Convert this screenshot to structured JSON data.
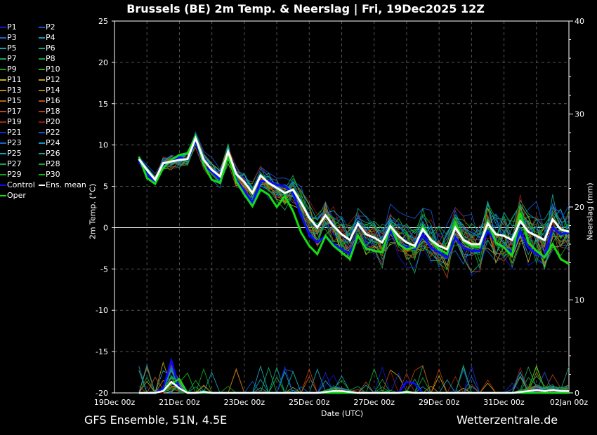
{
  "title": "Brussels  (BE)  2m Temp. & Neerslag | Fri, 19Dec2025 12Z",
  "footer_left": "GFS Ensemble, 51N, 4.5E",
  "footer_right": "Wetterzentrale.de",
  "chart_data": {
    "type": "line",
    "title": "Brussels  (BE)  2m Temp. & Neerslag | Fri, 19Dec2025 12Z",
    "xlabel": "Date (UTC)",
    "ylabel": "2m Temp. (°C)",
    "y2label": "Neerslag (mm)",
    "xlim_days": [
      0,
      14
    ],
    "x_start_day": 0.75,
    "x_step_days": 0.25,
    "ylim": [
      -20,
      25
    ],
    "y2lim": [
      0,
      40
    ],
    "yticks": [
      -20,
      -15,
      -10,
      -5,
      0,
      5,
      10,
      15,
      20,
      25
    ],
    "y2ticks": [
      0,
      10,
      20,
      30,
      40
    ],
    "xtick_labels": [
      "19Dec 00z",
      "21Dec 00z",
      "23Dec 00z",
      "25Dec 00z",
      "27Dec 00z",
      "29Dec 00z",
      "31Dec 00z",
      "02Jan 00z"
    ],
    "grid": true,
    "legend_position": "left-outside",
    "ens_mean": [
      8.3,
      7.0,
      5.8,
      7.8,
      8.0,
      8.2,
      8.3,
      10.8,
      8.2,
      7.0,
      6.2,
      9.2,
      6.5,
      5.5,
      4.2,
      6.3,
      5.4,
      4.8,
      4.2,
      4.6,
      3.0,
      1.2,
      0.0,
      1.5,
      0.2,
      -0.8,
      -1.5,
      0.5,
      -0.8,
      -1.2,
      -1.8,
      0.2,
      -1.0,
      -1.8,
      -2.2,
      -0.2,
      -1.5,
      -2.2,
      -2.6,
      0.0,
      -1.5,
      -2.0,
      -2.0,
      0.5,
      -0.8,
      -1.0,
      -1.5,
      0.8,
      -0.5,
      -1.0,
      -1.5,
      1.0,
      -0.2,
      -0.5
    ],
    "control": [
      8.0,
      6.5,
      5.5,
      7.5,
      8.0,
      8.5,
      8.2,
      10.5,
      7.5,
      6.8,
      5.8,
      8.8,
      5.8,
      4.5,
      3.0,
      5.6,
      5.6,
      5.2,
      5.0,
      4.2,
      1.5,
      -0.8,
      -1.8,
      -1.0,
      -2.0,
      -2.6,
      -3.2,
      -1.0,
      -2.4,
      -2.8,
      -3.0,
      -0.4,
      -2.0,
      -2.4,
      -2.6,
      -0.8,
      -2.4,
      -3.0,
      -3.6,
      -1.2,
      -2.4,
      -2.8,
      -2.8,
      -0.4,
      -1.8,
      -2.4,
      -3.0,
      -0.4,
      -2.4,
      -3.2,
      -3.6,
      0.0,
      -0.8,
      -0.6
    ],
    "oper": [
      8.6,
      6.0,
      5.3,
      7.2,
      8.2,
      8.8,
      9.0,
      11.0,
      7.6,
      5.8,
      5.4,
      8.6,
      5.6,
      4.0,
      2.6,
      4.6,
      4.0,
      2.5,
      3.8,
      2.0,
      -0.6,
      -2.2,
      -3.2,
      -1.0,
      -2.2,
      -3.0,
      -3.8,
      -1.0,
      -2.5,
      -2.8,
      -3.0,
      0.2,
      -2.0,
      -2.6,
      -2.4,
      0.2,
      -1.6,
      -2.6,
      -3.2,
      0.5,
      -1.6,
      -2.2,
      -2.4,
      0.8,
      -1.8,
      -2.4,
      -3.4,
      1.8,
      -1.8,
      -2.8,
      -3.6,
      -2.0,
      -3.8,
      -4.4
    ],
    "spread": [
      0.3,
      0.5,
      0.6,
      0.8,
      0.9,
      1.0,
      1.0,
      1.0,
      1.0,
      1.2,
      1.3,
      1.3,
      1.4,
      1.5,
      1.5,
      1.5,
      1.6,
      1.7,
      1.8,
      1.9,
      2.0,
      2.1,
      2.2,
      2.2,
      2.3,
      2.3,
      2.4,
      2.4,
      2.5,
      2.5,
      2.6,
      2.6,
      2.7,
      2.7,
      2.8,
      2.8,
      2.9,
      2.9,
      3.0,
      3.0,
      3.0,
      3.1,
      3.1,
      3.2,
      3.2,
      3.2,
      3.3,
      3.3,
      3.3,
      3.4,
      3.4,
      3.4,
      3.5,
      3.5
    ],
    "precip_mean": [
      0,
      0,
      0,
      0.2,
      1.2,
      0.5,
      0,
      0,
      0.1,
      0,
      0,
      0,
      0,
      0,
      0,
      0,
      0,
      0,
      0,
      0,
      0,
      0,
      0,
      0.1,
      0.2,
      0.2,
      0.1,
      0,
      0,
      0,
      0,
      0,
      0,
      0.1,
      0,
      0,
      0,
      0,
      0,
      0,
      0,
      0,
      0,
      0,
      0,
      0,
      0,
      0.1,
      0.2,
      0.3,
      0.2,
      0.3,
      0.2,
      0.2
    ],
    "precip_control": [
      0,
      0,
      0,
      0.5,
      3.5,
      0.5,
      0,
      0,
      0,
      0,
      0,
      0,
      0,
      0,
      0,
      0,
      0,
      0,
      0,
      0,
      0,
      0,
      0,
      0,
      0,
      0,
      0,
      0,
      0,
      0,
      0,
      0,
      0,
      1.2,
      1.0,
      0,
      0,
      0,
      0,
      0,
      0,
      0,
      0,
      0,
      0,
      0,
      0,
      0,
      0,
      0,
      0,
      0,
      0,
      0
    ],
    "precip_oper": [
      0,
      0,
      0,
      0.2,
      1.0,
      1.5,
      0,
      0,
      0,
      0,
      0,
      0,
      0,
      0,
      0,
      0,
      0,
      0,
      0,
      0,
      0,
      0,
      0,
      0,
      0,
      0,
      0,
      0,
      0,
      0,
      0,
      0,
      0,
      0,
      0,
      0,
      0,
      0,
      0,
      0,
      0,
      0,
      0,
      0,
      0,
      0,
      0,
      0,
      0,
      0,
      0,
      0,
      0,
      0
    ],
    "series": [
      {
        "name": "P1",
        "color": "#1414c8"
      },
      {
        "name": "P2",
        "color": "#1450c8"
      },
      {
        "name": "P3",
        "color": "#1464c8"
      },
      {
        "name": "P4",
        "color": "#1496c8"
      },
      {
        "name": "P5",
        "color": "#14a0b4"
      },
      {
        "name": "P6",
        "color": "#14a08c"
      },
      {
        "name": "P7",
        "color": "#14a064"
      },
      {
        "name": "P8",
        "color": "#14a03c"
      },
      {
        "name": "P9",
        "color": "#14a014"
      },
      {
        "name": "P10",
        "color": "#14b414"
      },
      {
        "name": "P11",
        "color": "#b4b414"
      },
      {
        "name": "P12",
        "color": "#b4a014"
      },
      {
        "name": "P13",
        "color": "#b48c14"
      },
      {
        "name": "P14",
        "color": "#b47814"
      },
      {
        "name": "P15",
        "color": "#b46414"
      },
      {
        "name": "P16",
        "color": "#b45014"
      },
      {
        "name": "P17",
        "color": "#b44614"
      },
      {
        "name": "P18",
        "color": "#b43c14"
      },
      {
        "name": "P19",
        "color": "#a02814"
      },
      {
        "name": "P20",
        "color": "#961414"
      },
      {
        "name": "P21",
        "color": "#1428c8"
      },
      {
        "name": "P22",
        "color": "#1450c8"
      },
      {
        "name": "P23",
        "color": "#1464c8"
      },
      {
        "name": "P24",
        "color": "#1496c8"
      },
      {
        "name": "P25",
        "color": "#14a0b4"
      },
      {
        "name": "P26",
        "color": "#14a08c"
      },
      {
        "name": "P27",
        "color": "#14a064"
      },
      {
        "name": "P28",
        "color": "#14a03c"
      },
      {
        "name": "P29",
        "color": "#14a014"
      },
      {
        "name": "P30",
        "color": "#14b414"
      },
      {
        "name": "Control",
        "color": "#0a0aff"
      },
      {
        "name": "Ens. mean",
        "color": "#ffffff"
      },
      {
        "name": "Oper",
        "color": "#14dc14"
      }
    ]
  }
}
